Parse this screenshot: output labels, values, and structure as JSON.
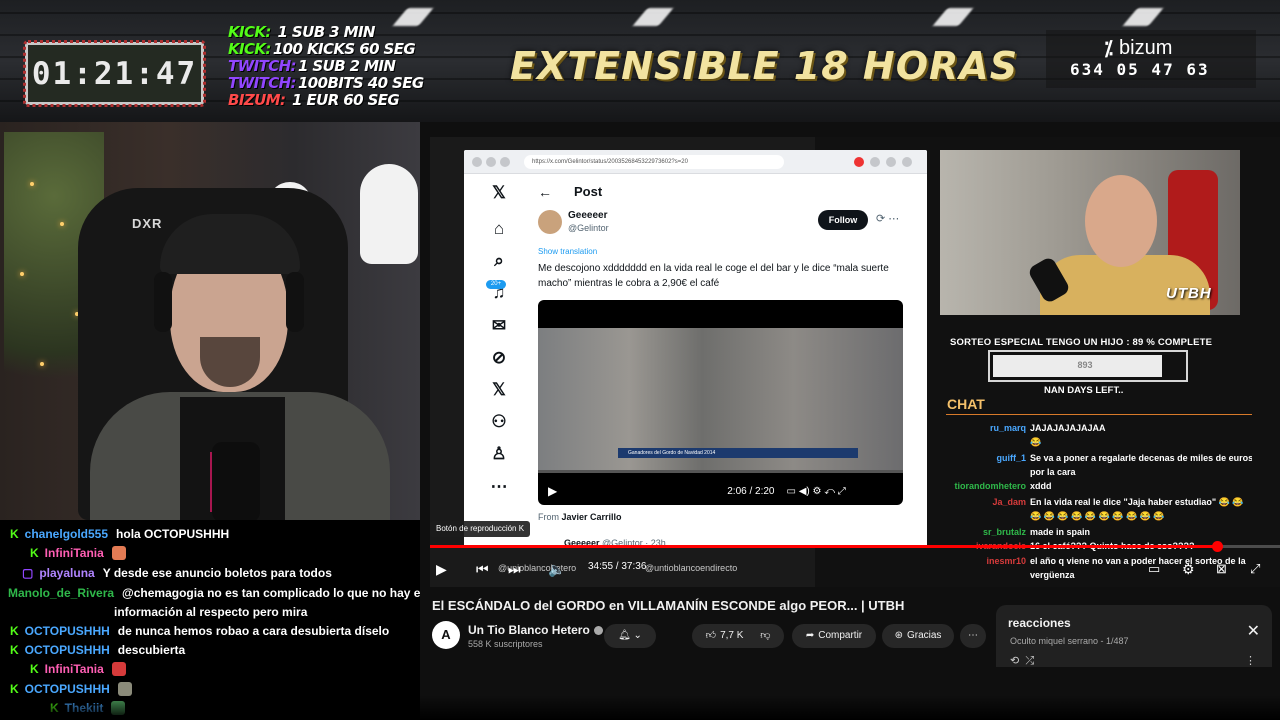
{
  "banner": {
    "timer": "01:21:47",
    "rules": [
      {
        "label": "KICK:",
        "text": " 1 SUB 3 MIN",
        "color": "#53fc18"
      },
      {
        "label": "KICK:",
        "text": "100 KICKS 60 SEG",
        "color": "#53fc18"
      },
      {
        "label": "TWITCH:",
        "text": "1 SUB 2 MIN",
        "color": "#9146ff"
      },
      {
        "label": "TWITCH:",
        "text": "100BITS 40 SEG",
        "color": "#9146ff"
      },
      {
        "label": "BIZUM:",
        "text": " 1 EUR 60 SEG",
        "color": "#ff4a4a"
      }
    ],
    "headline": "EXTENSIBLE 18 HORAS",
    "bizum_logo": "bizum",
    "bizum_phone": "634 05 47 63"
  },
  "webcam_left": {
    "chair_brand": "DXR"
  },
  "chat_left": [
    {
      "badge": "K",
      "badge_color": "#53fc18",
      "user": "chanelgold555",
      "user_color": "#4aa8ff",
      "message": "hola OCTOPUSHHH"
    },
    {
      "badge": "K",
      "badge_color": "#53fc18",
      "user": "InfiniTania",
      "user_color": "#ff5fb4",
      "message": "",
      "emote_color": "#e37b54"
    },
    {
      "badge": "▢",
      "badge_color": "#9146ff",
      "user": "playaluna",
      "user_color": "#b084ff",
      "message": "Y desde ese anuncio boletos para todos"
    },
    {
      "badge": "",
      "badge_color": "#53fc18",
      "user": "Manolo_de_Rivera",
      "user_color": "#2fb84a",
      "message": "@chemagogia no es tan complicado lo que no hay es"
    },
    {
      "badge": "",
      "badge_color": "#53fc18",
      "user": "",
      "user_color": "#fff",
      "message": "información al respecto pero mira"
    },
    {
      "badge": "K",
      "badge_color": "#53fc18",
      "user": "OCTOPUSHHH",
      "user_color": "#4aa8ff",
      "message": "de nunca hemos robao a cara desubierta díselo"
    },
    {
      "badge": "K",
      "badge_color": "#53fc18",
      "user": "OCTOPUSHHH",
      "user_color": "#4aa8ff",
      "message": "descubierta"
    },
    {
      "badge": "K",
      "badge_color": "#53fc18",
      "user": "InfiniTania",
      "user_color": "#ff5fb4",
      "message": "",
      "emote_color": "#d63b3b"
    },
    {
      "badge": "K",
      "badge_color": "#53fc18",
      "user": "OCTOPUSHHH",
      "user_color": "#4aa8ff",
      "message": "",
      "emote_color": "#8b8b7a"
    },
    {
      "badge": "K",
      "badge_color": "#53fc18",
      "user": "Thekiit",
      "user_color": "#4aa8ff",
      "message": "",
      "emote_color": "#4ea35e"
    }
  ],
  "post": {
    "url": "https://x.com/Gelintor/status/2003526845322973602?s=20",
    "title": "Post",
    "name": "Geeeeer",
    "handle": "@Gelintor",
    "follow_label": "Follow",
    "translate": "Show translation",
    "text": "Me descojono xddddddd en la vida real le coge el del bar y le dice “mala suerte macho” mientras le cobra a 2,90€ el café",
    "video_lower_third": "Ganadores del Gordo de Navidad 2014",
    "video_time": "2:06 / 2:20",
    "from_label": "From",
    "from_name": "Javier Carrillo",
    "next_name": "Geeeeer",
    "next_handle": "@Gelintor · 23h",
    "sidebar_badge": "20+"
  },
  "player": {
    "tooltip": "Botón de reproducción   K",
    "time": "34:55 / 37:36",
    "watermark1": "@unioblancohetero",
    "watermark2": "@untioblancoendirecto",
    "progress": 0.926
  },
  "cam_right": {
    "logo": "UTBH"
  },
  "sorteo": {
    "title": "SORTEO ESPECIAL TENGO UN HIJO :  89 % COMPLETE",
    "value": "893",
    "progress": 0.89,
    "days": "NAN DAYS LEFT.."
  },
  "chat_right": {
    "title": "CHAT",
    "rows": [
      {
        "user": "ru_marq",
        "user_color": "#4aa8ff",
        "message": "JAJAJAJAJAJAA"
      },
      {
        "user": "",
        "user_color": "#4aa8ff",
        "message": "😂"
      },
      {
        "user": "guiff_1",
        "user_color": "#4aa8ff",
        "message": "Se va a poner a regalarle decenas de miles de euros"
      },
      {
        "user": "",
        "user_color": "#fff",
        "message": "por la cara"
      },
      {
        "user": "tiorandomhetero",
        "user_color": "#2fb84a",
        "message": "xddd"
      },
      {
        "user": "Ja_dam",
        "user_color": "#d63b3b",
        "message": "En la vida real le dice \"Jaja haber estudiao\" 😂 😂"
      },
      {
        "user": "",
        "user_color": "#fff",
        "message": "😂 😂 😂 😂 😂 😂 😂 😂 😂 😂"
      },
      {
        "user": "sr_brutalz",
        "user_color": "#2fb84a",
        "message": "made in spain"
      },
      {
        "user": "ivarandoele",
        "user_color": "#d63b3b",
        "message": "16 el café??? Quinto hace de eso????"
      },
      {
        "user": "inesmr10",
        "user_color": "#d63b3b",
        "message": "el año q viene no van a poder hacer el sorteo de la"
      },
      {
        "user": "",
        "user_color": "#fff",
        "message": "vergüenza"
      }
    ]
  },
  "video": {
    "title": "El ESCÁNDALO del GORDO en VILLAMANÍN ESCONDE algo PEOR... | UTBH",
    "channel": "Un Tio Blanco Hetero",
    "subscribers": "558 K suscriptores",
    "likes": "7,7 K",
    "share": "Compartir",
    "thanks": "Gracias",
    "avatar_letter": "A"
  },
  "reactions_panel": {
    "title": "reacciones",
    "subtitle": "Oculto  miquel serrano - 1/487"
  },
  "colors": {
    "youtube_red": "#ff0000",
    "kick_green": "#53fc18",
    "twitch_purple": "#9146ff",
    "chat_title": "#f4c06a"
  }
}
